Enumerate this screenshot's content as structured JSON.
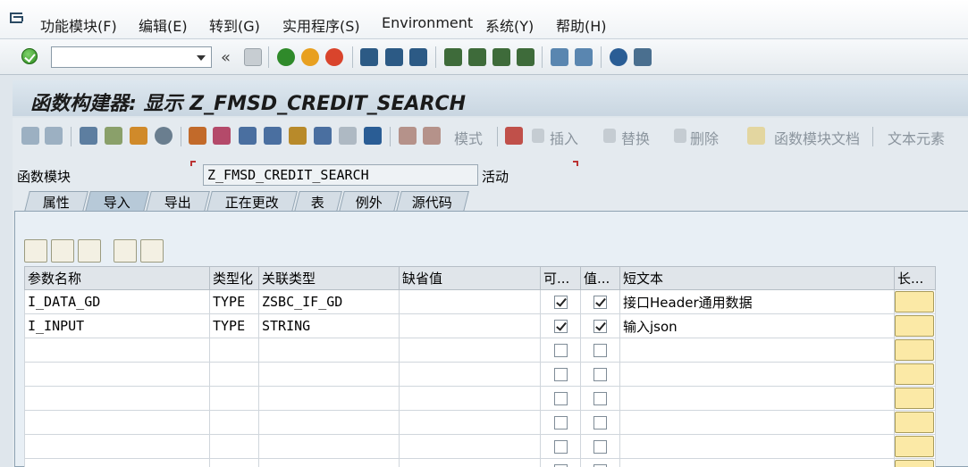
{
  "menubar": {
    "items": [
      "功能模块(F)",
      "编辑(E)",
      "转到(G)",
      "实用程序(S)",
      "Environment",
      "系统(Y)",
      "帮助(H)"
    ]
  },
  "system_toolbar": {
    "command_field_value": "",
    "back_chevron": "«"
  },
  "title": "函数构建器: 显示 Z_FMSD_CREDIT_SEARCH",
  "app_toolbar": {
    "mode_label": "模式",
    "insert_label": "插入",
    "replace_label": "替换",
    "delete_label": "删除",
    "fm_doc_label": "函数模块文档",
    "text_elements_label": "文本元素"
  },
  "function_module": {
    "label": "函数模块",
    "value": "Z_FMSD_CREDIT_SEARCH",
    "status": "活动"
  },
  "tabs": [
    "属性",
    "导入",
    "导出",
    "正在更改",
    "表",
    "例外",
    "源代码"
  ],
  "active_tab": "导入",
  "table": {
    "headers": [
      "参数名称",
      "类型化",
      "关联类型",
      "缺省值",
      "可...",
      "值...",
      "短文本",
      "长..."
    ],
    "rows": [
      {
        "name": "I_DATA_GD",
        "typing": "TYPE",
        "assoc_type": "ZSBC_IF_GD",
        "default": "",
        "optional": true,
        "pass_value": true,
        "short_text": "接口Header通用数据"
      },
      {
        "name": "I_INPUT",
        "typing": "TYPE",
        "assoc_type": "STRING",
        "default": "",
        "optional": true,
        "pass_value": true,
        "short_text": "输入json"
      }
    ],
    "empty_rows": 6
  }
}
